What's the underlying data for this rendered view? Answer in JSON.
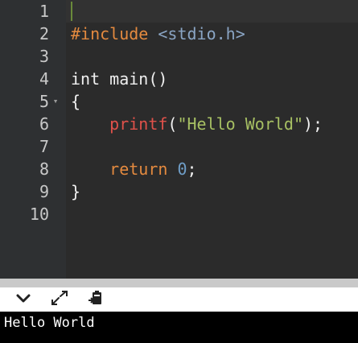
{
  "editor": {
    "lines": [
      {
        "num": "1",
        "tokens": []
      },
      {
        "num": "2",
        "tokens": [
          {
            "t": "#include ",
            "c": "pre"
          },
          {
            "t": "<stdio.h>",
            "c": "hdr"
          }
        ]
      },
      {
        "num": "3",
        "tokens": []
      },
      {
        "num": "4",
        "tokens": [
          {
            "t": "int main()",
            "c": ""
          }
        ]
      },
      {
        "num": "5",
        "tokens": [
          {
            "t": "{",
            "c": ""
          }
        ],
        "fold": true
      },
      {
        "num": "6",
        "tokens": [
          {
            "t": "    ",
            "c": ""
          },
          {
            "t": "printf",
            "c": "fn"
          },
          {
            "t": "(",
            "c": ""
          },
          {
            "t": "\"Hello World\"",
            "c": "str"
          },
          {
            "t": ");",
            "c": ""
          }
        ]
      },
      {
        "num": "7",
        "tokens": []
      },
      {
        "num": "8",
        "tokens": [
          {
            "t": "    ",
            "c": ""
          },
          {
            "t": "return",
            "c": "kw"
          },
          {
            "t": " ",
            "c": ""
          },
          {
            "t": "0",
            "c": "num"
          },
          {
            "t": ";",
            "c": ""
          }
        ]
      },
      {
        "num": "9",
        "tokens": [
          {
            "t": "}",
            "c": ""
          }
        ]
      },
      {
        "num": "10",
        "tokens": []
      }
    ],
    "fold_marker": "▾"
  },
  "toolbar": {
    "icons": [
      "chevron-down-icon",
      "expand-icon",
      "clipboard-icon"
    ]
  },
  "output": {
    "text": "Hello World"
  }
}
